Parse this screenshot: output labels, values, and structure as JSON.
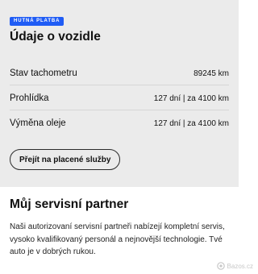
{
  "vehicle": {
    "badge": "HUTNÁ PLATBA",
    "title": "Údaje o vozidle",
    "rows": [
      {
        "label": "Stav tachometru",
        "value": "89245 km"
      },
      {
        "label": "Prohlídka",
        "value": "127 dní | za 4100 km"
      },
      {
        "label": "Výměna oleje",
        "value": "127 dní | za 4100 km"
      }
    ],
    "button_label": "Přejít na placené služby"
  },
  "partner": {
    "title": "Můj servisní partner",
    "description": "Naši autorizovaní servisní partneři nabízejí kompletní servis, vysoko kvalifikovaný personál a nejnovější technologie. Tvé auto je v dobrých rukou."
  },
  "watermark": {
    "icon": "bazos-logo-icon",
    "text": "Bazos.cz"
  }
}
